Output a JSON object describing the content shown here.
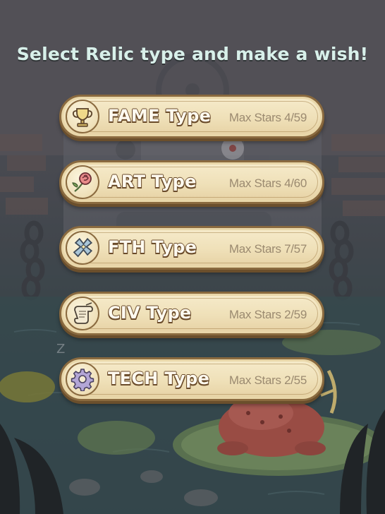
{
  "title": "Select Relic type and make a wish!",
  "relics": [
    {
      "name": "FAME Type",
      "stars": "Max Stars 4/59",
      "icon": "trophy-icon"
    },
    {
      "name": "ART Type",
      "stars": "Max Stars 4/60",
      "icon": "rose-icon"
    },
    {
      "name": "FTH Type",
      "stars": "Max Stars 7/57",
      "icon": "cross-icon"
    },
    {
      "name": "CIV Type",
      "stars": "Max Stars 2/59",
      "icon": "scroll-icon"
    },
    {
      "name": "TECH Type",
      "stars": "Max Stars 2/55",
      "icon": "gear-icon"
    }
  ],
  "colors": {
    "title": "#d8f0ea",
    "button_fill": "#f2e4bf",
    "button_border": "#8a6a3f",
    "stars_text": "#9b8a70"
  }
}
